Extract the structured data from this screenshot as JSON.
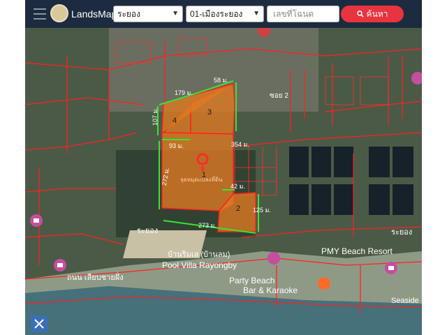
{
  "app": {
    "title": "LandsMaps"
  },
  "toolbar": {
    "province_value": "ระยอง",
    "district_value": "01-เมืองระยอง",
    "deed_placeholder": "เลขที่โฉนด",
    "search_label": "ค้นหา"
  },
  "map": {
    "plot_numbers": [
      "1",
      "2",
      "3",
      "4"
    ],
    "plot_fill_color": "#e07a20",
    "boundary_color": "#ff2020",
    "measurement_color": "#33e633",
    "dimensions": {
      "d179": "179 ม.",
      "d58": "58 ม.",
      "d107": "107 ม.",
      "d93": "93 ม.",
      "d354": "354 ม.",
      "d272": "272 ม.",
      "d42": "42 ม.",
      "d125": "125 ม.",
      "d273": "273 ม."
    },
    "place_labels": {
      "pmy": "PMY Beach Resort",
      "pool_villa_th": "บ้านริมเล (บ้านลม)",
      "pool_villa": "Pool Villa Rayongby",
      "party": "Party Beach",
      "bar": "Bar & Karaoke",
      "seaside": "Seaside",
      "road_beach": "ถนน เลียบชายฝั่ง",
      "rayong_1": "ระยอง",
      "rayong_2": "ระยอง",
      "soi": "ซอย 2",
      "land_mark": "จุดหมุดแปลงที่ดิน"
    }
  }
}
